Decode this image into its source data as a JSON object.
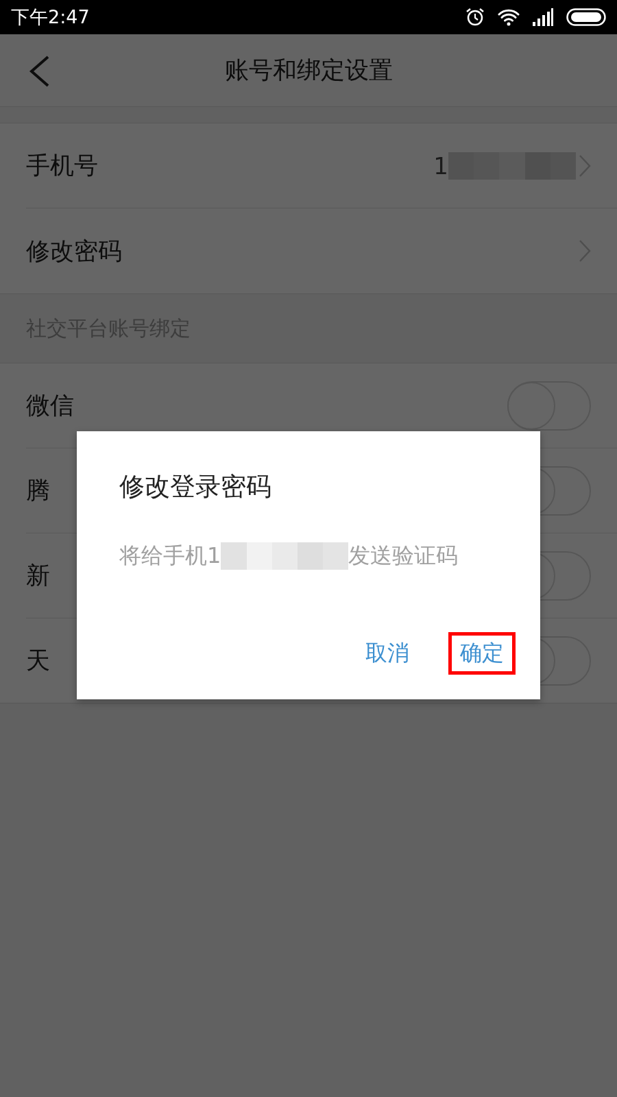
{
  "status_bar": {
    "time": "下午2:47"
  },
  "header": {
    "title": "账号和绑定设置"
  },
  "account_rows": [
    {
      "label": "手机号",
      "value": "1",
      "redacted": true
    },
    {
      "label": "修改密码",
      "redacted": false
    }
  ],
  "section_title": "社交平台账号绑定",
  "bindings": [
    {
      "label": "微信",
      "on": false
    },
    {
      "label": "腾",
      "on": false
    },
    {
      "label": "新",
      "on": false
    },
    {
      "label": "天",
      "on": false
    }
  ],
  "dialog": {
    "title": "修改登录密码",
    "message_before": "将给手机1",
    "message_after": "发送验证码",
    "buttons": [
      {
        "label": "取消",
        "highlighted": false
      },
      {
        "label": "确定",
        "highlighted": true
      }
    ]
  }
}
